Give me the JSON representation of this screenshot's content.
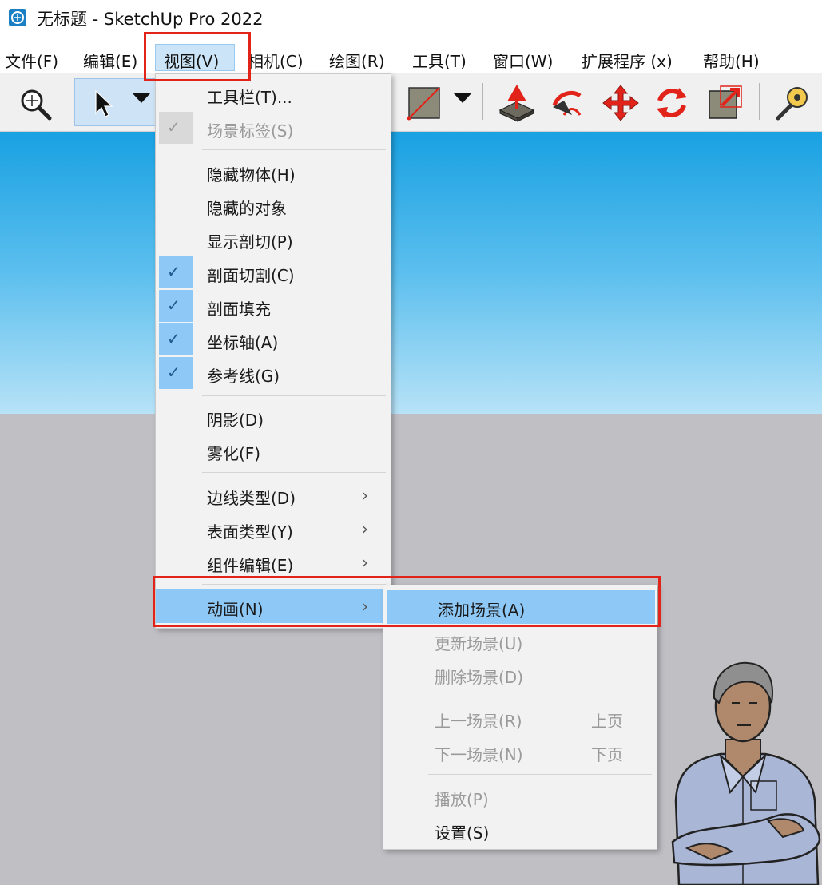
{
  "window": {
    "title": "无标题 - SketchUp Pro 2022"
  },
  "menubar": {
    "items": [
      "文件(F)",
      "编辑(E)",
      "视图(V)",
      "相机(C)",
      "绘图(R)",
      "工具(T)",
      "窗口(W)",
      "扩展程序 (x)",
      "帮助(H)"
    ]
  },
  "view_menu": {
    "items": [
      {
        "label": "工具栏(T)..."
      },
      {
        "label": "场景标签(S)"
      },
      {
        "label": "隐藏物体(H)"
      },
      {
        "label": "隐藏的对象"
      },
      {
        "label": "显示剖切(P)"
      },
      {
        "label": "剖面切割(C)"
      },
      {
        "label": "剖面填充"
      },
      {
        "label": "坐标轴(A)"
      },
      {
        "label": "参考线(G)"
      },
      {
        "label": "阴影(D)"
      },
      {
        "label": "雾化(F)"
      },
      {
        "label": "边线类型(D)"
      },
      {
        "label": "表面类型(Y)"
      },
      {
        "label": "组件编辑(E)"
      },
      {
        "label": "动画(N)"
      }
    ]
  },
  "animation_submenu": {
    "items": [
      {
        "label": "添加场景(A)"
      },
      {
        "label": "更新场景(U)"
      },
      {
        "label": "删除场景(D)"
      },
      {
        "label": "上一场景(R)",
        "shortcut": "上页"
      },
      {
        "label": "下一场景(N)",
        "shortcut": "下页"
      },
      {
        "label": "播放(P)"
      },
      {
        "label": "设置(S)"
      }
    ]
  },
  "icons": {
    "checkmark": "✓",
    "submenu_arrow": "›"
  },
  "colors": {
    "highlight": "#8ec8f6",
    "annotation_red": "#e2231a",
    "sky_top": "#19a1e2",
    "ground": "#bfbfc4"
  }
}
